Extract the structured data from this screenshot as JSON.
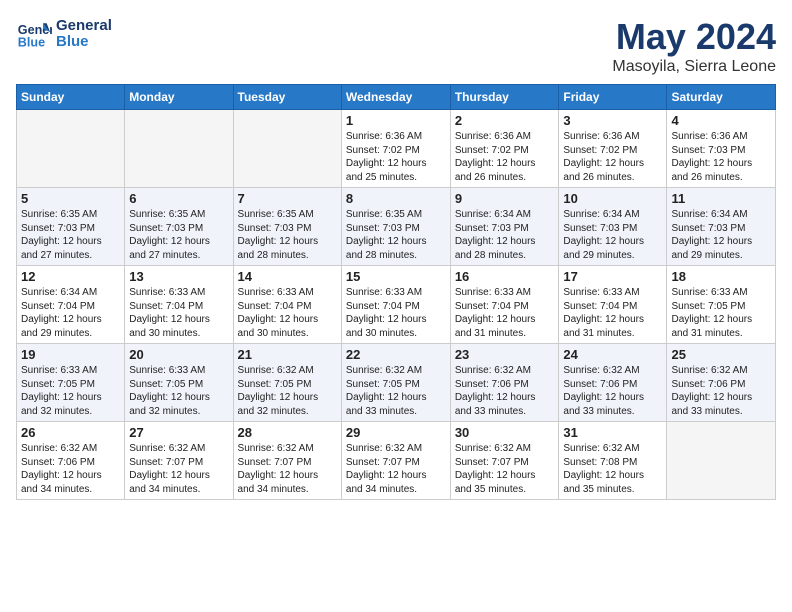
{
  "header": {
    "logo_line1": "General",
    "logo_line2": "Blue",
    "month": "May 2024",
    "location": "Masoyila, Sierra Leone"
  },
  "weekdays": [
    "Sunday",
    "Monday",
    "Tuesday",
    "Wednesday",
    "Thursday",
    "Friday",
    "Saturday"
  ],
  "weeks": [
    [
      {
        "day": "",
        "content": ""
      },
      {
        "day": "",
        "content": ""
      },
      {
        "day": "",
        "content": ""
      },
      {
        "day": "1",
        "content": "Sunrise: 6:36 AM\nSunset: 7:02 PM\nDaylight: 12 hours\nand 25 minutes."
      },
      {
        "day": "2",
        "content": "Sunrise: 6:36 AM\nSunset: 7:02 PM\nDaylight: 12 hours\nand 26 minutes."
      },
      {
        "day": "3",
        "content": "Sunrise: 6:36 AM\nSunset: 7:02 PM\nDaylight: 12 hours\nand 26 minutes."
      },
      {
        "day": "4",
        "content": "Sunrise: 6:36 AM\nSunset: 7:03 PM\nDaylight: 12 hours\nand 26 minutes."
      }
    ],
    [
      {
        "day": "5",
        "content": "Sunrise: 6:35 AM\nSunset: 7:03 PM\nDaylight: 12 hours\nand 27 minutes."
      },
      {
        "day": "6",
        "content": "Sunrise: 6:35 AM\nSunset: 7:03 PM\nDaylight: 12 hours\nand 27 minutes."
      },
      {
        "day": "7",
        "content": "Sunrise: 6:35 AM\nSunset: 7:03 PM\nDaylight: 12 hours\nand 28 minutes."
      },
      {
        "day": "8",
        "content": "Sunrise: 6:35 AM\nSunset: 7:03 PM\nDaylight: 12 hours\nand 28 minutes."
      },
      {
        "day": "9",
        "content": "Sunrise: 6:34 AM\nSunset: 7:03 PM\nDaylight: 12 hours\nand 28 minutes."
      },
      {
        "day": "10",
        "content": "Sunrise: 6:34 AM\nSunset: 7:03 PM\nDaylight: 12 hours\nand 29 minutes."
      },
      {
        "day": "11",
        "content": "Sunrise: 6:34 AM\nSunset: 7:03 PM\nDaylight: 12 hours\nand 29 minutes."
      }
    ],
    [
      {
        "day": "12",
        "content": "Sunrise: 6:34 AM\nSunset: 7:04 PM\nDaylight: 12 hours\nand 29 minutes."
      },
      {
        "day": "13",
        "content": "Sunrise: 6:33 AM\nSunset: 7:04 PM\nDaylight: 12 hours\nand 30 minutes."
      },
      {
        "day": "14",
        "content": "Sunrise: 6:33 AM\nSunset: 7:04 PM\nDaylight: 12 hours\nand 30 minutes."
      },
      {
        "day": "15",
        "content": "Sunrise: 6:33 AM\nSunset: 7:04 PM\nDaylight: 12 hours\nand 30 minutes."
      },
      {
        "day": "16",
        "content": "Sunrise: 6:33 AM\nSunset: 7:04 PM\nDaylight: 12 hours\nand 31 minutes."
      },
      {
        "day": "17",
        "content": "Sunrise: 6:33 AM\nSunset: 7:04 PM\nDaylight: 12 hours\nand 31 minutes."
      },
      {
        "day": "18",
        "content": "Sunrise: 6:33 AM\nSunset: 7:05 PM\nDaylight: 12 hours\nand 31 minutes."
      }
    ],
    [
      {
        "day": "19",
        "content": "Sunrise: 6:33 AM\nSunset: 7:05 PM\nDaylight: 12 hours\nand 32 minutes."
      },
      {
        "day": "20",
        "content": "Sunrise: 6:33 AM\nSunset: 7:05 PM\nDaylight: 12 hours\nand 32 minutes."
      },
      {
        "day": "21",
        "content": "Sunrise: 6:32 AM\nSunset: 7:05 PM\nDaylight: 12 hours\nand 32 minutes."
      },
      {
        "day": "22",
        "content": "Sunrise: 6:32 AM\nSunset: 7:05 PM\nDaylight: 12 hours\nand 33 minutes."
      },
      {
        "day": "23",
        "content": "Sunrise: 6:32 AM\nSunset: 7:06 PM\nDaylight: 12 hours\nand 33 minutes."
      },
      {
        "day": "24",
        "content": "Sunrise: 6:32 AM\nSunset: 7:06 PM\nDaylight: 12 hours\nand 33 minutes."
      },
      {
        "day": "25",
        "content": "Sunrise: 6:32 AM\nSunset: 7:06 PM\nDaylight: 12 hours\nand 33 minutes."
      }
    ],
    [
      {
        "day": "26",
        "content": "Sunrise: 6:32 AM\nSunset: 7:06 PM\nDaylight: 12 hours\nand 34 minutes."
      },
      {
        "day": "27",
        "content": "Sunrise: 6:32 AM\nSunset: 7:07 PM\nDaylight: 12 hours\nand 34 minutes."
      },
      {
        "day": "28",
        "content": "Sunrise: 6:32 AM\nSunset: 7:07 PM\nDaylight: 12 hours\nand 34 minutes."
      },
      {
        "day": "29",
        "content": "Sunrise: 6:32 AM\nSunset: 7:07 PM\nDaylight: 12 hours\nand 34 minutes."
      },
      {
        "day": "30",
        "content": "Sunrise: 6:32 AM\nSunset: 7:07 PM\nDaylight: 12 hours\nand 35 minutes."
      },
      {
        "day": "31",
        "content": "Sunrise: 6:32 AM\nSunset: 7:08 PM\nDaylight: 12 hours\nand 35 minutes."
      },
      {
        "day": "",
        "content": ""
      }
    ]
  ]
}
